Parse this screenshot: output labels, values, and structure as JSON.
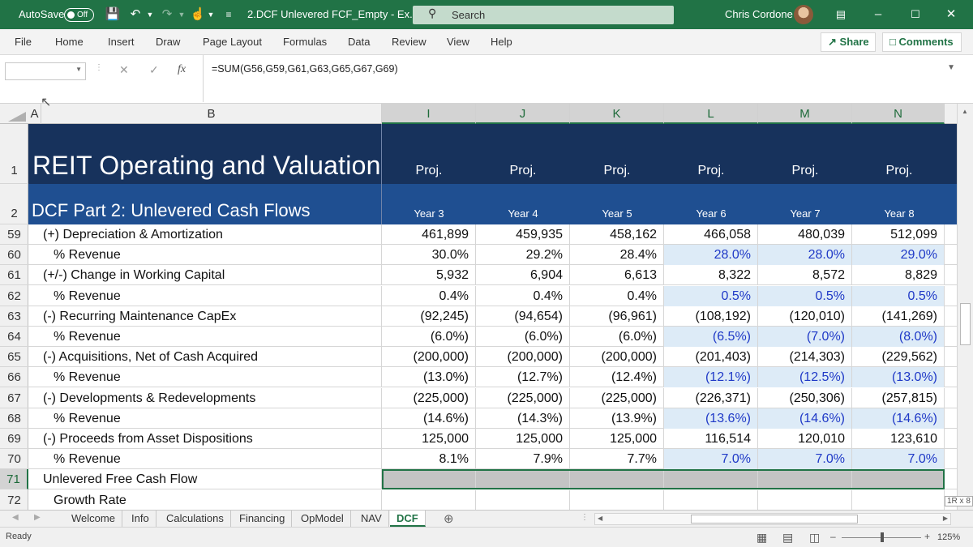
{
  "titlebar": {
    "autosave_label": "AutoSave",
    "autosave_state": "Off",
    "file_title": "2.DCF Unlevered FCF_Empty  -  Ex...",
    "search_label": "Search",
    "user_name": "Chris Cordone"
  },
  "ribbon": {
    "menus": [
      "File",
      "Home",
      "Insert",
      "Draw",
      "Page Layout",
      "Formulas",
      "Data",
      "Review",
      "View",
      "Help"
    ],
    "share_label": "Share",
    "comments_label": "Comments"
  },
  "formula_bar": {
    "name_box": "",
    "fx_label": "fx",
    "formula": "=SUM(G56,G59,G61,G63,G65,G67,G69)"
  },
  "columns": [
    "A",
    "B",
    "I",
    "J",
    "K",
    "L",
    "M",
    "N"
  ],
  "banner": {
    "title": "REIT Operating and Valuation",
    "subtitle": "DCF Part 2: Unlevered Cash Flows",
    "proj_labels": [
      "Proj.",
      "Proj.",
      "Proj.",
      "Proj.",
      "Proj.",
      "Proj."
    ],
    "year_labels": [
      "Year 3",
      "Year 4",
      "Year 5",
      "Year 6",
      "Year 7",
      "Year 8"
    ],
    "row_numbers": [
      "1",
      "2"
    ]
  },
  "rows": [
    {
      "num": "59",
      "label": "(+) Depreciation & Amortization",
      "indent": false,
      "input": false,
      "values": [
        "461,899",
        "459,935",
        "458,162",
        "466,058",
        "480,039",
        "512,099"
      ]
    },
    {
      "num": "60",
      "label": "% Revenue",
      "indent": true,
      "input": true,
      "values": [
        "30.0%",
        "29.2%",
        "28.4%",
        "28.0%",
        "28.0%",
        "29.0%"
      ]
    },
    {
      "num": "61",
      "label": "(+/-) Change in Working Capital",
      "indent": false,
      "input": false,
      "values": [
        "5,932",
        "6,904",
        "6,613",
        "8,322",
        "8,572",
        "8,829"
      ]
    },
    {
      "num": "62",
      "label": "% Revenue",
      "indent": true,
      "input": true,
      "values": [
        "0.4%",
        "0.4%",
        "0.4%",
        "0.5%",
        "0.5%",
        "0.5%"
      ]
    },
    {
      "num": "63",
      "label": "(-) Recurring Maintenance CapEx",
      "indent": false,
      "input": false,
      "values": [
        "(92,245)",
        "(94,654)",
        "(96,961)",
        "(108,192)",
        "(120,010)",
        "(141,269)"
      ]
    },
    {
      "num": "64",
      "label": "% Revenue",
      "indent": true,
      "input": true,
      "values": [
        "(6.0%)",
        "(6.0%)",
        "(6.0%)",
        "(6.5%)",
        "(7.0%)",
        "(8.0%)"
      ]
    },
    {
      "num": "65",
      "label": "(-) Acquisitions, Net of Cash Acquired",
      "indent": false,
      "input": false,
      "values": [
        "(200,000)",
        "(200,000)",
        "(200,000)",
        "(201,403)",
        "(214,303)",
        "(229,562)"
      ]
    },
    {
      "num": "66",
      "label": "% Revenue",
      "indent": true,
      "input": true,
      "values": [
        "(13.0%)",
        "(12.7%)",
        "(12.4%)",
        "(12.1%)",
        "(12.5%)",
        "(13.0%)"
      ]
    },
    {
      "num": "67",
      "label": "(-) Developments & Redevelopments",
      "indent": false,
      "input": false,
      "values": [
        "(225,000)",
        "(225,000)",
        "(225,000)",
        "(226,371)",
        "(250,306)",
        "(257,815)"
      ]
    },
    {
      "num": "68",
      "label": "% Revenue",
      "indent": true,
      "input": true,
      "values": [
        "(14.6%)",
        "(14.3%)",
        "(13.9%)",
        "(13.6%)",
        "(14.6%)",
        "(14.6%)"
      ]
    },
    {
      "num": "69",
      "label": "(-) Proceeds from Asset Dispositions",
      "indent": false,
      "input": false,
      "values": [
        "125,000",
        "125,000",
        "125,000",
        "116,514",
        "120,010",
        "123,610"
      ]
    },
    {
      "num": "70",
      "label": "% Revenue",
      "indent": true,
      "input": true,
      "values": [
        "8.1%",
        "7.9%",
        "7.7%",
        "7.0%",
        "7.0%",
        "7.0%"
      ]
    },
    {
      "num": "71",
      "label": "Unlevered Free Cash Flow",
      "indent": false,
      "input": false,
      "selected": true,
      "values": [
        "",
        "",
        "",
        "",
        "",
        ""
      ]
    },
    {
      "num": "72",
      "label": "Growth Rate",
      "indent": true,
      "input": false,
      "values": [
        "",
        "",
        "",
        "",
        "",
        ""
      ]
    }
  ],
  "sheet_tabs": [
    "Welcome",
    "Info",
    "Calculations",
    "Financing",
    "OpModel",
    "NAV",
    "DCF"
  ],
  "active_tab": "DCF",
  "selection_tip": "1R x 8",
  "status": {
    "ready": "Ready",
    "zoom": "125%"
  },
  "colors": {
    "excel_green": "#217346",
    "banner_dark": "#17325c",
    "banner_mid": "#1f4f91",
    "input_fill": "#ddebf7",
    "input_text": "#1f39c7"
  }
}
